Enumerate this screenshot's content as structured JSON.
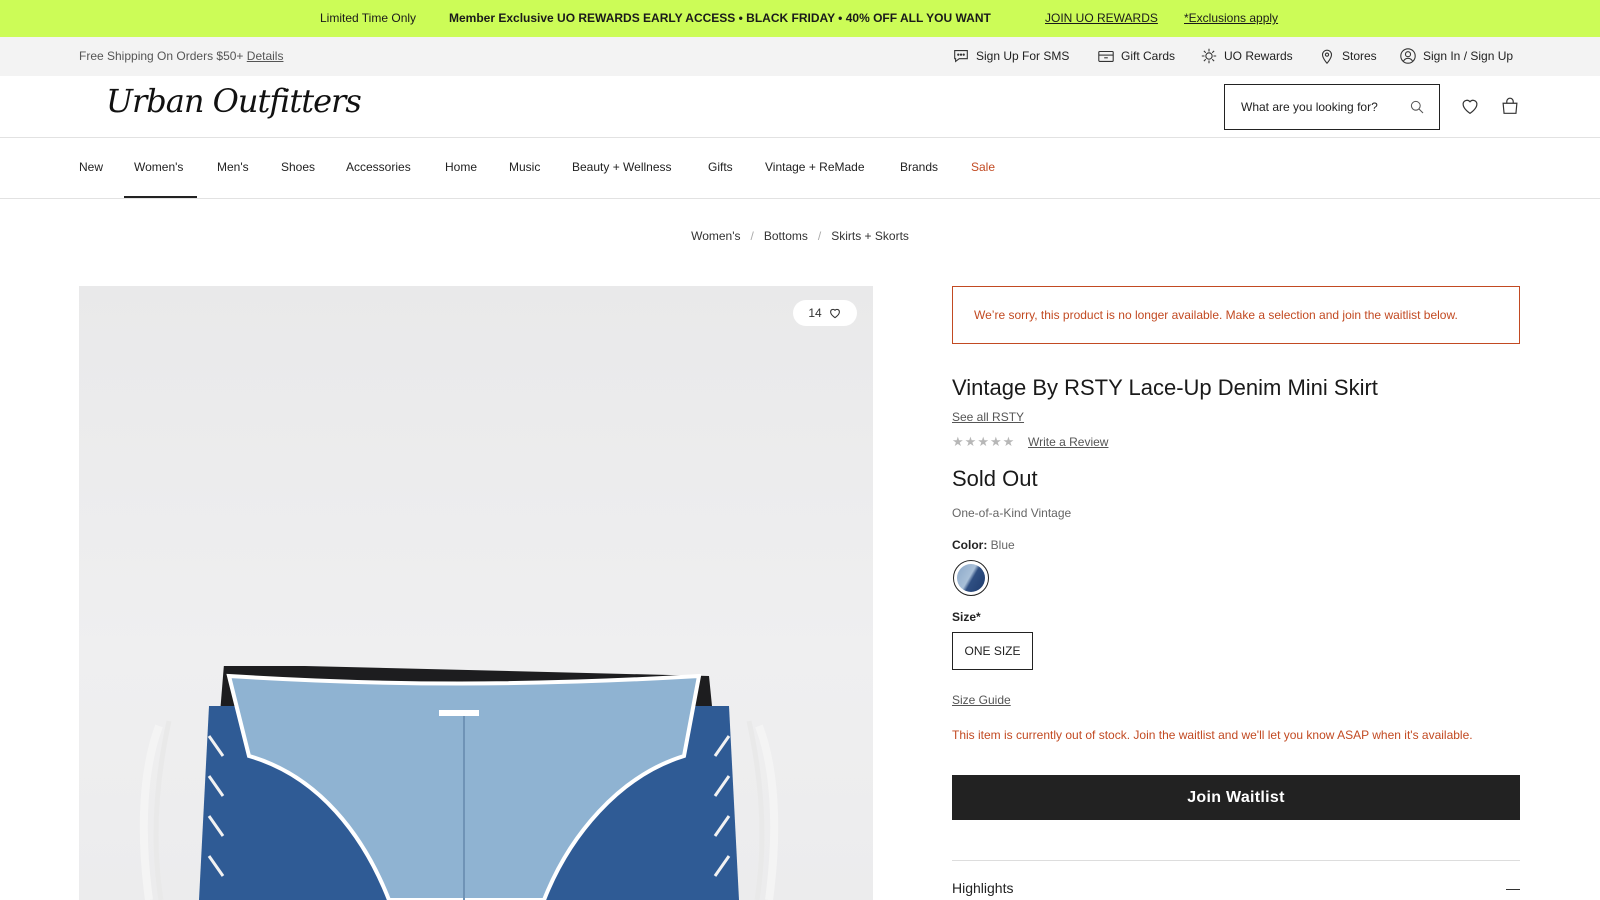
{
  "promo": {
    "limited": "Limited Time Only",
    "message": "Member Exclusive UO REWARDS EARLY ACCESS • BLACK FRIDAY • 40% OFF ALL YOU WANT",
    "join_link": "JOIN UO REWARDS",
    "exclusions_link": "*Exclusions apply",
    "background": "#ccfc57"
  },
  "utility": {
    "shipping_text": "Free Shipping On Orders $50+",
    "details_link": "Details",
    "items": [
      {
        "label": "Sign Up For SMS",
        "icon": "chat-icon"
      },
      {
        "label": "Gift Cards",
        "icon": "gift-card-icon"
      },
      {
        "label": "UO Rewards",
        "icon": "sun-icon"
      },
      {
        "label": "Stores",
        "icon": "location-pin-icon"
      },
      {
        "label": "Sign In / Sign Up",
        "icon": "user-icon"
      }
    ]
  },
  "header": {
    "logo": "Urban Outfitters",
    "search_placeholder": "What are you looking for?"
  },
  "nav": {
    "items": [
      "New",
      "Women's",
      "Men's",
      "Shoes",
      "Accessories",
      "Home",
      "Music",
      "Beauty + Wellness",
      "Gifts",
      "Vintage + ReMade",
      "Brands",
      "Sale"
    ],
    "active": "Women's",
    "sale_color": "#c24a22"
  },
  "breadcrumb": [
    "Women's",
    "Bottoms",
    "Skirts + Skorts"
  ],
  "gallery": {
    "like_count": "14"
  },
  "product": {
    "alert": "We’re sorry, this product is no longer available. Make a selection and join the waitlist below.",
    "title": "Vintage By RSTY Lace-Up Denim Mini Skirt",
    "see_all": "See all RSTY",
    "rating_stars": 0,
    "write_review": "Write a Review",
    "price_status": "Sold Out",
    "subtitle": "One-of-a-Kind Vintage",
    "color_label": "Color:",
    "color_value": "Blue",
    "size_label": "Size*",
    "size_option": "ONE SIZE",
    "size_guide": "Size Guide",
    "out_of_stock_msg": "This item is currently out of stock. Join the waitlist and we'll let you know ASAP when it's available.",
    "waitlist_button": "Join Waitlist",
    "highlights_label": "Highlights",
    "accent_color": "#c24a22"
  }
}
